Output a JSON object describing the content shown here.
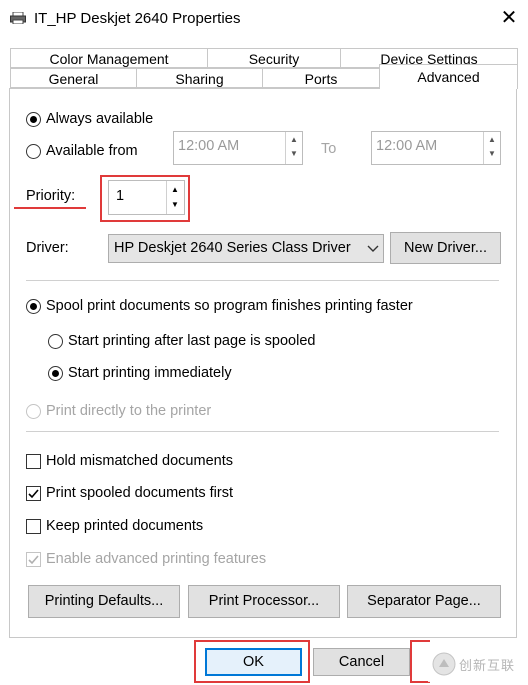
{
  "window": {
    "title": "IT_HP Deskjet 2640 Properties",
    "close_glyph": "✕"
  },
  "tabs_back": [
    {
      "label": "Color Management"
    },
    {
      "label": "Security"
    },
    {
      "label": "Device Settings"
    }
  ],
  "tabs_front": [
    {
      "label": "General"
    },
    {
      "label": "Sharing"
    },
    {
      "label": "Ports"
    },
    {
      "label": "Advanced"
    }
  ],
  "availability": {
    "always_label": "Always available",
    "from_label": "Available from",
    "selected": "always",
    "from_time": "12:00 AM",
    "to_label": "To",
    "to_time": "12:00 AM"
  },
  "priority": {
    "label": "Priority:",
    "value": "1"
  },
  "driver": {
    "label": "Driver:",
    "selected": "HP Deskjet 2640 Series Class Driver",
    "new_driver_label": "New Driver..."
  },
  "spool": {
    "spool_label": "Spool print documents so program finishes printing faster",
    "after_last_label": "Start printing after last page is spooled",
    "immediately_label": "Start printing immediately",
    "direct_label": "Print directly to the printer"
  },
  "options": {
    "hold_label": "Hold mismatched documents",
    "hold_checked": false,
    "spooled_first_label": "Print spooled documents first",
    "spooled_first_checked": true,
    "keep_label": "Keep printed documents",
    "keep_checked": false,
    "advanced_features_label": "Enable advanced printing features",
    "advanced_features_checked": true
  },
  "buttons": {
    "printing_defaults": "Printing Defaults...",
    "print_processor": "Print Processor...",
    "separator_page": "Separator Page...",
    "ok": "OK",
    "cancel": "Cancel"
  },
  "watermark": {
    "text": "创新互联"
  },
  "colors": {
    "annotation": "#e03a3a",
    "focus": "#0078d7"
  }
}
